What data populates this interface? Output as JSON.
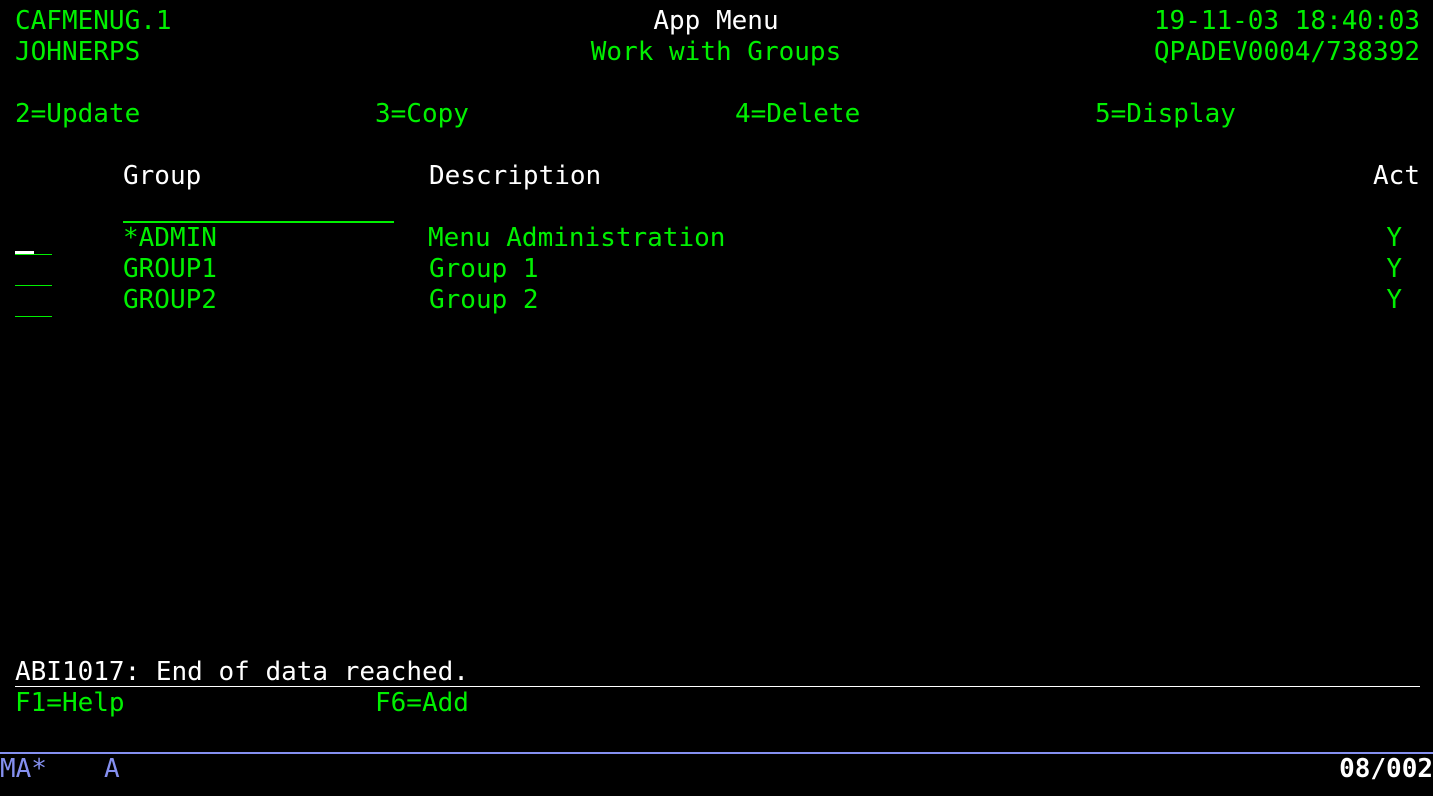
{
  "header": {
    "program": "CAFMENUG.1",
    "user": "JOHNERPS",
    "app_title": "App Menu",
    "screen_title": "Work with Groups",
    "datetime": "19-11-03 18:40:03",
    "device": "QPADEV0004/738392"
  },
  "options": [
    {
      "label": "2=Update"
    },
    {
      "label": "3=Copy"
    },
    {
      "label": "4=Delete"
    },
    {
      "label": "5=Display"
    }
  ],
  "columns": {
    "group": "Group",
    "description": "Description",
    "active": "Act"
  },
  "rows": [
    {
      "group": "*ADMIN",
      "description": "Menu Administration",
      "active": "Y"
    },
    {
      "group": "GROUP1",
      "description": "Group 1",
      "active": "Y"
    },
    {
      "group": "GROUP2",
      "description": "Group 2",
      "active": "Y"
    }
  ],
  "message": "ABI1017: End of data reached.",
  "function_keys": [
    {
      "label": "F1=Help"
    },
    {
      "label": "F6=Add"
    }
  ],
  "status_bar": {
    "mode": "MA*",
    "indicator": "A",
    "cursor_position": "08/002"
  },
  "colors": {
    "background": "#000000",
    "field_text": "#00f000",
    "heading_text": "#ffffff",
    "status_text": "#8590f0"
  }
}
